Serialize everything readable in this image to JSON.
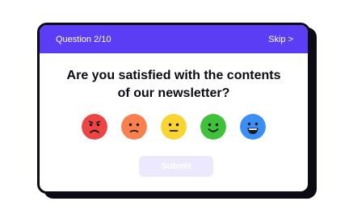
{
  "header": {
    "progress_label": "Question 2/10",
    "skip_label": "Skip >"
  },
  "question": {
    "line1": "Are you satisfied with the contents",
    "line2": "of our newsletter?"
  },
  "ratings": [
    {
      "name": "very-unsatisfied-face-icon",
      "color": "#ef4444"
    },
    {
      "name": "unsatisfied-face-icon",
      "color": "#f97f4f"
    },
    {
      "name": "neutral-face-icon",
      "color": "#f8d531"
    },
    {
      "name": "satisfied-face-icon",
      "color": "#3fc23a"
    },
    {
      "name": "very-satisfied-face-icon",
      "color": "#3b8ef5"
    }
  ],
  "submit": {
    "label": "Submit"
  },
  "colors": {
    "accent": "#5b3df5",
    "border": "#0b0b14",
    "submit_disabled": "#ece9fd"
  }
}
